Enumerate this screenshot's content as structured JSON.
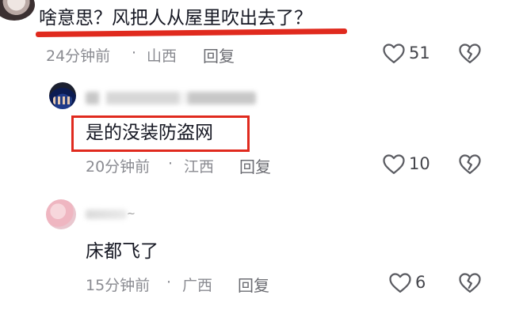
{
  "comments": [
    {
      "text": "啥意思？风把人从屋里吹出去了？",
      "time": "24分钟前",
      "dot": "·",
      "location": "山西",
      "reply_label": "回复",
      "like_count": "51"
    },
    {
      "text": "是的没装防盗网",
      "time": "20分钟前",
      "dot": "·",
      "location": "江西",
      "reply_label": "回复",
      "like_count": "10"
    },
    {
      "text": "床都飞了",
      "time": "15分钟前",
      "dot": "·",
      "location": "广西",
      "reply_label": "回复",
      "like_count": "6"
    }
  ],
  "colors": {
    "highlight": "#e02a1e",
    "text": "#161823",
    "meta": "#8a8b91"
  },
  "icons": [
    "heart-outline-icon",
    "broken-heart-icon"
  ]
}
